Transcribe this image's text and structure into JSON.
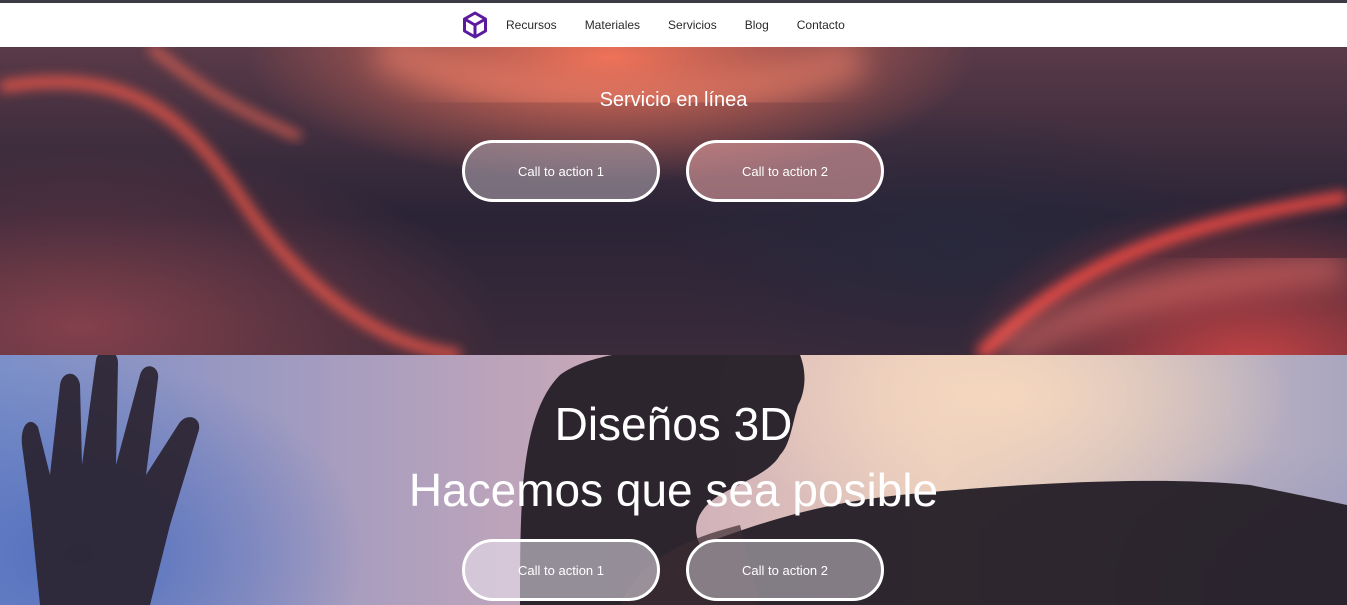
{
  "nav": {
    "logo_icon": "cube-icon",
    "links": [
      "Recursos",
      "Materiales",
      "Servicios",
      "Blog",
      "Contacto"
    ]
  },
  "hero1": {
    "subtitle": "Servicio en línea",
    "cta1": "Call to action 1",
    "cta2": "Call to action 2"
  },
  "hero2": {
    "title_line1": "Diseños 3D",
    "title_line2": "Hacemos que sea posible",
    "cta1": "Call to action 1",
    "cta2": "Call to action 2"
  },
  "colors": {
    "logo": "#5b1a9e",
    "nav_text": "#2a2a2a",
    "white": "#ffffff"
  }
}
